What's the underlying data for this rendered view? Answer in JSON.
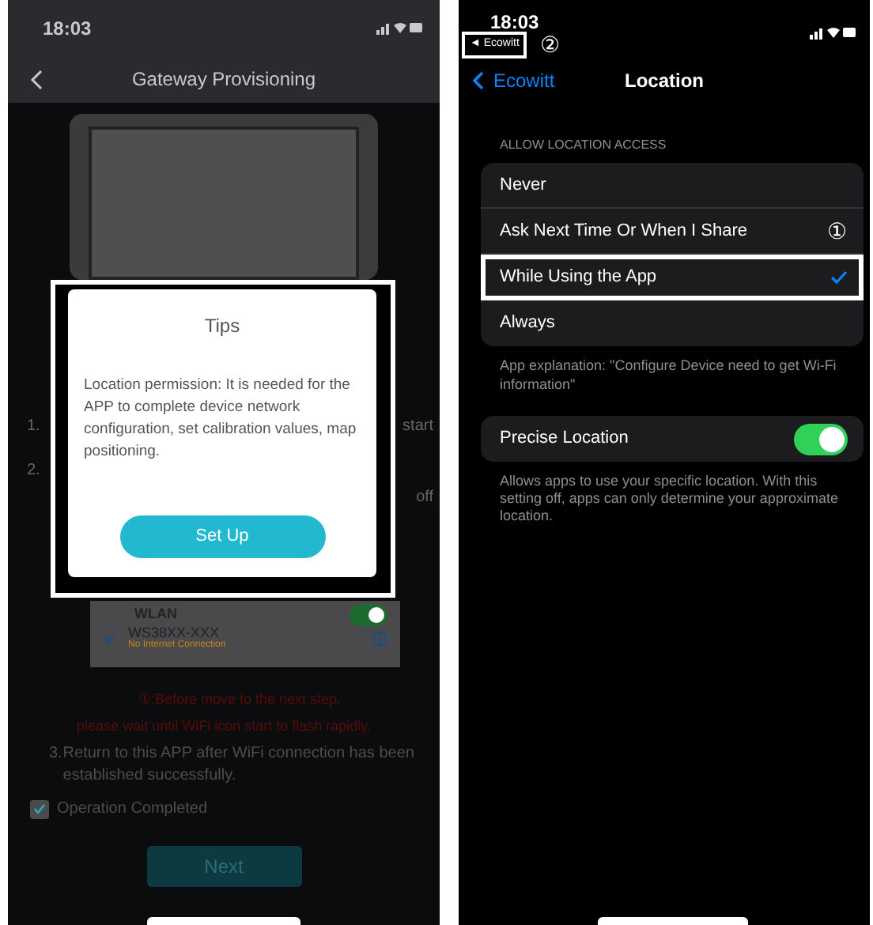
{
  "left_screen": {
    "status_bar": {
      "time": "18:03"
    },
    "nav": {
      "title": "Gateway Provisioning"
    },
    "step_fragments": [
      {
        "number": "1.",
        "visible_end": "start"
      },
      {
        "number": "2.",
        "visible_end": "off"
      }
    ],
    "dialog": {
      "title": "Tips",
      "body": "Location permission: It is needed for the APP to complete device network configuration, set calibration values, map positioning.",
      "button": "Set Up"
    },
    "wifi_screenshot": {
      "label": "WLAN",
      "toggle_on": true,
      "network": {
        "name": "WS38XX-XXX",
        "status": "No Internet Connection",
        "selected": true
      }
    },
    "notes": [
      "①:Before move to the next step,",
      "please wait until WiFi icon start to flash rapidly."
    ],
    "step_3": {
      "number": "3.",
      "text": "Return to this APP after WiFi connection has been established successfully."
    },
    "completed": {
      "label": "Operation Completed",
      "checked": true
    },
    "next_button": "Next"
  },
  "right_screen": {
    "status_bar": {
      "time": "18:03",
      "back_app": "◄ Ecowitt",
      "marker": "②"
    },
    "nav": {
      "back": "Ecowitt",
      "title": "Location"
    },
    "section_header": "ALLOW LOCATION ACCESS",
    "options": [
      {
        "label": "Never",
        "selected": false,
        "highlighted": false
      },
      {
        "label": "Ask Next Time Or When I Share",
        "selected": false,
        "highlighted": false,
        "marker": "①"
      },
      {
        "label": "While Using the App",
        "selected": true,
        "highlighted": true
      },
      {
        "label": "Always",
        "selected": false,
        "highlighted": false
      }
    ],
    "explanation": "App explanation: \"Configure Device need to get Wi-Fi information\"",
    "precise": {
      "label": "Precise Location",
      "on": true
    },
    "footer": "Allows apps to use your specific location. With this setting off, apps can only determine your approximate location."
  }
}
